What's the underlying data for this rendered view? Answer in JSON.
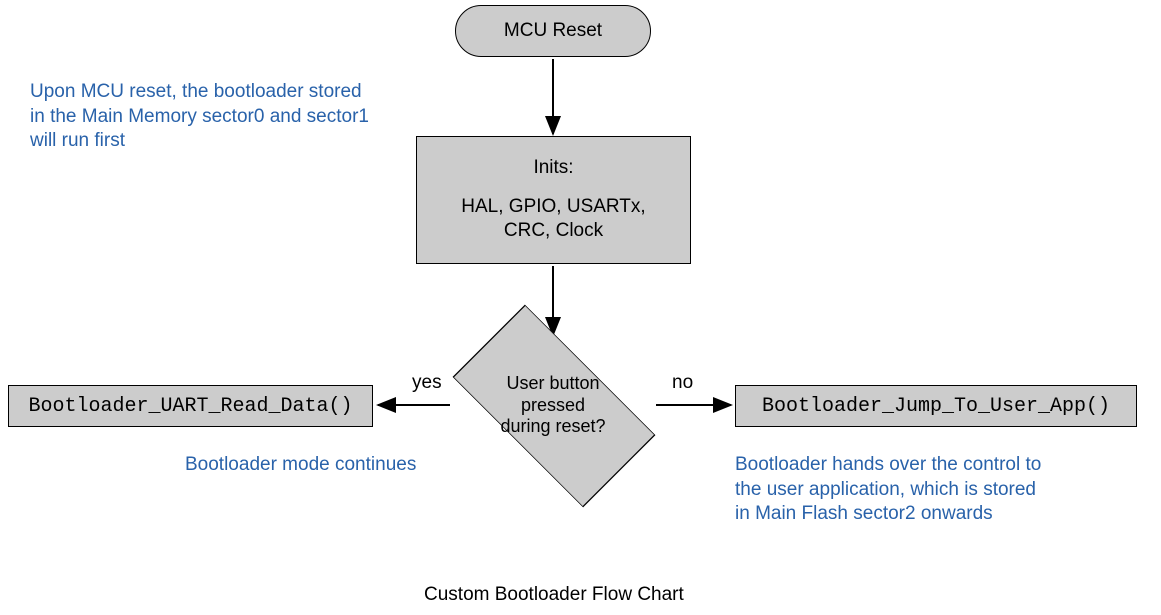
{
  "nodes": {
    "start": "MCU Reset",
    "inits_title": "Inits:",
    "inits_body": "HAL, GPIO, USARTx,\nCRC, Clock",
    "decision": "User button\npressed\nduring reset?",
    "left_proc": "Bootloader_UART_Read_Data()",
    "right_proc": "Bootloader_Jump_To_User_App()"
  },
  "edges": {
    "yes": "yes",
    "no": "no"
  },
  "annotations": {
    "top_left": "Upon MCU reset, the bootloader stored\nin the Main Memory sector0 and sector1\nwill run first",
    "bottom_left": "Bootloader mode continues",
    "bottom_right": "Bootloader hands over the control to\nthe user application, which is stored\nin Main Flash sector2 onwards"
  },
  "caption": "Custom Bootloader Flow Chart"
}
